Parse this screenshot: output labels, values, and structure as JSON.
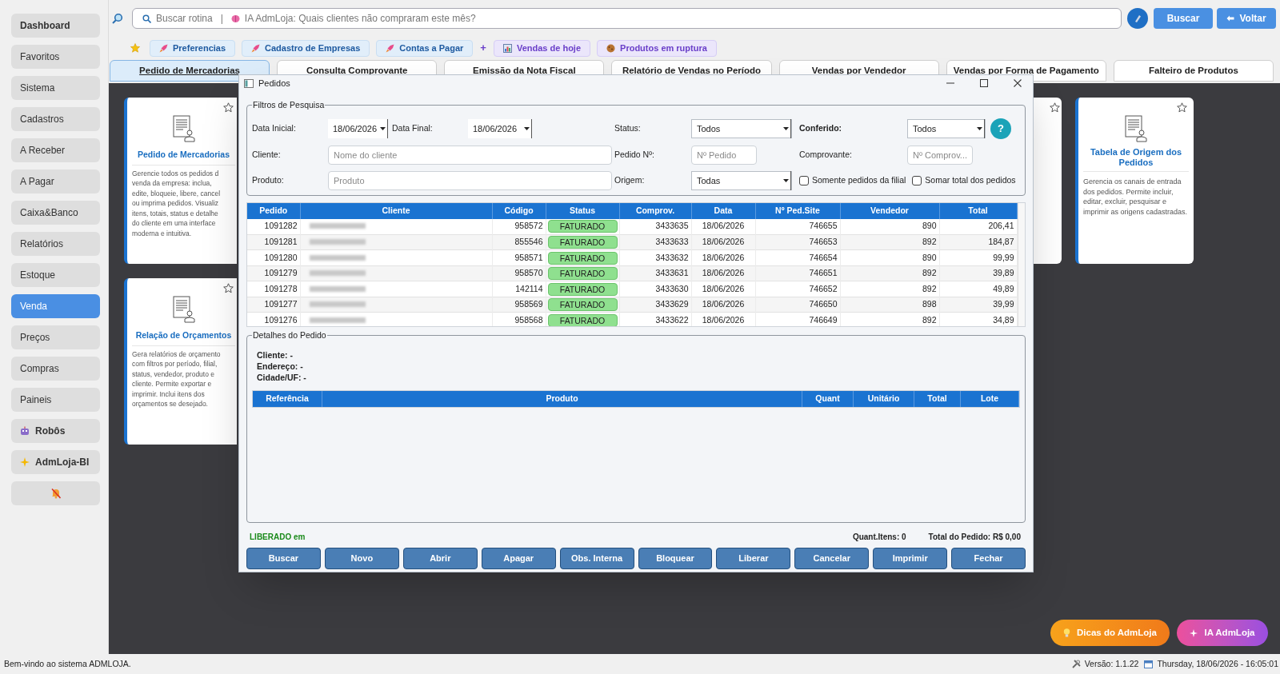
{
  "sidebar": {
    "items": [
      {
        "label": "Dashboard",
        "bold": true,
        "selected": false
      },
      {
        "label": "Favoritos",
        "bold": false,
        "selected": false
      },
      {
        "label": "Sistema",
        "bold": false,
        "selected": false
      },
      {
        "label": "Cadastros",
        "bold": false,
        "selected": false
      },
      {
        "label": "A Receber",
        "bold": false,
        "selected": false
      },
      {
        "label": "A Pagar",
        "bold": false,
        "selected": false
      },
      {
        "label": "Caixa&Banco",
        "bold": false,
        "selected": false
      },
      {
        "label": "Relatórios",
        "bold": false,
        "selected": false
      },
      {
        "label": "Estoque",
        "bold": false,
        "selected": false
      },
      {
        "label": "Venda",
        "bold": false,
        "selected": true
      },
      {
        "label": "Preços",
        "bold": false,
        "selected": false
      },
      {
        "label": "Compras",
        "bold": false,
        "selected": false
      },
      {
        "label": "Paineis",
        "bold": false,
        "selected": false
      },
      {
        "label": "Robôs",
        "bold": true,
        "kind": "robot",
        "selected": false
      },
      {
        "label": "AdmLoja-BI",
        "bold": true,
        "kind": "sparkle",
        "selected": false
      },
      {
        "kind": "muted-bell",
        "selected": false
      }
    ]
  },
  "search": {
    "placeholder": "Buscar rotina",
    "separator": "|",
    "ai_hint": "IA AdmLoja: Quais clientes não compraram este mês?"
  },
  "toolbar_buttons": [
    {
      "label": "Buscar",
      "kind": "plain"
    },
    {
      "label": "Voltar",
      "kind": "back"
    }
  ],
  "shortcuts": {
    "favorites": [
      {
        "label": "Preferencias",
        "kind": "rocket"
      },
      {
        "label": "Cadastro de Empresas",
        "kind": "rocket"
      },
      {
        "label": "Contas a Pagar",
        "kind": "rocket"
      }
    ],
    "add_symbol": "+",
    "suggestions": [
      {
        "label": "Vendas de hoje",
        "kind": "chart"
      },
      {
        "label": "Produtos em ruptura",
        "kind": "box"
      }
    ]
  },
  "tabs": [
    {
      "label": "Pedido de Mercadorias",
      "selected": true
    },
    {
      "label": "Consulta Comprovante",
      "selected": false
    },
    {
      "label": "Emissão da Nota Fiscal",
      "selected": false
    },
    {
      "label": "Relatório de Vendas no Período",
      "selected": false
    },
    {
      "label": "Vendas por Vendedor",
      "selected": false
    },
    {
      "label": "Vendas por Forma de Pagamento",
      "selected": false
    },
    {
      "label": "Falteiro de Produtos",
      "selected": false
    }
  ],
  "cards": [
    {
      "title": "Pedido de Mercadorias",
      "lines": [
        "Gerencie todos os pedidos d",
        "venda da empresa: inclua,",
        "edite, bloqueie, libere, cancel",
        "ou imprima pedidos. Visualiz",
        "itens, totais, status e detalhe",
        "do cliente em uma interface",
        "moderna e intuitiva."
      ]
    },
    {
      "title": "Relação de Orçamentos",
      "lines": [
        "Gera relatórios de orçamento",
        "com filtros por período, filial,",
        "status, vendedor, produto e",
        "cliente. Permite exportar e",
        "imprimir. Inclui itens dos",
        "orçamentos se desejado."
      ]
    }
  ],
  "right_card": {
    "title": "Tabela de Origem dos Pedidos",
    "description": "Gerencia os canais de entrada dos pedidos. Permite incluir, editar, excluir, pesquisar e imprimir as origens cadastradas."
  },
  "dialog": {
    "title": "Pedidos",
    "filters": {
      "legend": "Filtros de Pesquisa",
      "data_inicial": {
        "label": "Data Inicial:",
        "value": "18/06/2026"
      },
      "data_final": {
        "label": "Data Final:",
        "value": "18/06/2026"
      },
      "status": {
        "label": "Status:",
        "value": "Todos"
      },
      "conferido": {
        "label": "Conferido:",
        "value": "Todos"
      },
      "help": "?",
      "cliente": {
        "label": "Cliente:",
        "placeholder": "Nome do cliente"
      },
      "pedido": {
        "label": "Pedido Nº:",
        "placeholder": "Nº Pedido"
      },
      "comprovante": {
        "label": "Comprovante:",
        "placeholder": "Nº Comprov..."
      },
      "produto": {
        "label": "Produto:",
        "placeholder": "Produto"
      },
      "origem": {
        "label": "Origem:",
        "value": "Todas"
      },
      "checkboxes": [
        {
          "label": "Somente pedidos da filial",
          "checked": false
        },
        {
          "label": "Somar total dos pedidos",
          "checked": false
        }
      ]
    },
    "orders": {
      "columns": [
        "Pedido",
        "Cliente",
        "Código",
        "Status",
        "Comprov.",
        "Data",
        "Nº Ped.Site",
        "Vendedor",
        "Total"
      ],
      "rows": [
        {
          "pedido": "1091282",
          "codigo": "958572",
          "status": "FATURADO",
          "comprov": "3433635",
          "data": "18/06/2026",
          "ped_site": "746655",
          "vendedor": "890",
          "total": "206,41"
        },
        {
          "pedido": "1091281",
          "codigo": "855546",
          "status": "FATURADO",
          "comprov": "3433633",
          "data": "18/06/2026",
          "ped_site": "746653",
          "vendedor": "892",
          "total": "184,87"
        },
        {
          "pedido": "1091280",
          "codigo": "958571",
          "status": "FATURADO",
          "comprov": "3433632",
          "data": "18/06/2026",
          "ped_site": "746654",
          "vendedor": "890",
          "total": "99,99"
        },
        {
          "pedido": "1091279",
          "codigo": "958570",
          "status": "FATURADO",
          "comprov": "3433631",
          "data": "18/06/2026",
          "ped_site": "746651",
          "vendedor": "892",
          "total": "39,89"
        },
        {
          "pedido": "1091278",
          "codigo": "142114",
          "status": "FATURADO",
          "comprov": "3433630",
          "data": "18/06/2026",
          "ped_site": "746652",
          "vendedor": "892",
          "total": "49,89"
        },
        {
          "pedido": "1091277",
          "codigo": "958569",
          "status": "FATURADO",
          "comprov": "3433629",
          "data": "18/06/2026",
          "ped_site": "746650",
          "vendedor": "898",
          "total": "39,99"
        },
        {
          "pedido": "1091276",
          "codigo": "958568",
          "status": "FATURADO",
          "comprov": "3433622",
          "data": "18/06/2026",
          "ped_site": "746649",
          "vendedor": "892",
          "total": "34,89"
        }
      ]
    },
    "details": {
      "legend": "Detalhes do Pedido",
      "lines": [
        "Cliente: -",
        "Endereço: -",
        "Cidade/UF: -"
      ],
      "item_columns": [
        "Referência",
        "Produto",
        "Quant",
        "Unitário",
        "Total",
        "Lote"
      ]
    },
    "footer": {
      "status": "LIBERADO em",
      "quant_itens": "Quant.Itens: 0",
      "total": "Total do Pedido: R$ 0,00"
    },
    "buttons": [
      "Buscar",
      "Novo",
      "Abrir",
      "Apagar",
      "Obs. Interna",
      "Bloquear",
      "Liberar",
      "Cancelar",
      "Imprimir",
      "Fechar"
    ]
  },
  "floating_buttons": [
    {
      "label": "Dicas do AdmLoja",
      "kind": "tips"
    },
    {
      "label": "IA AdmLoja",
      "kind": "ai"
    }
  ],
  "status_bar": {
    "message": "Bem-vindo ao sistema ADMLOJA.",
    "version": "Versão: 1.1.22",
    "datetime": "Thursday, 18/06/2026 - 16:05:01"
  }
}
